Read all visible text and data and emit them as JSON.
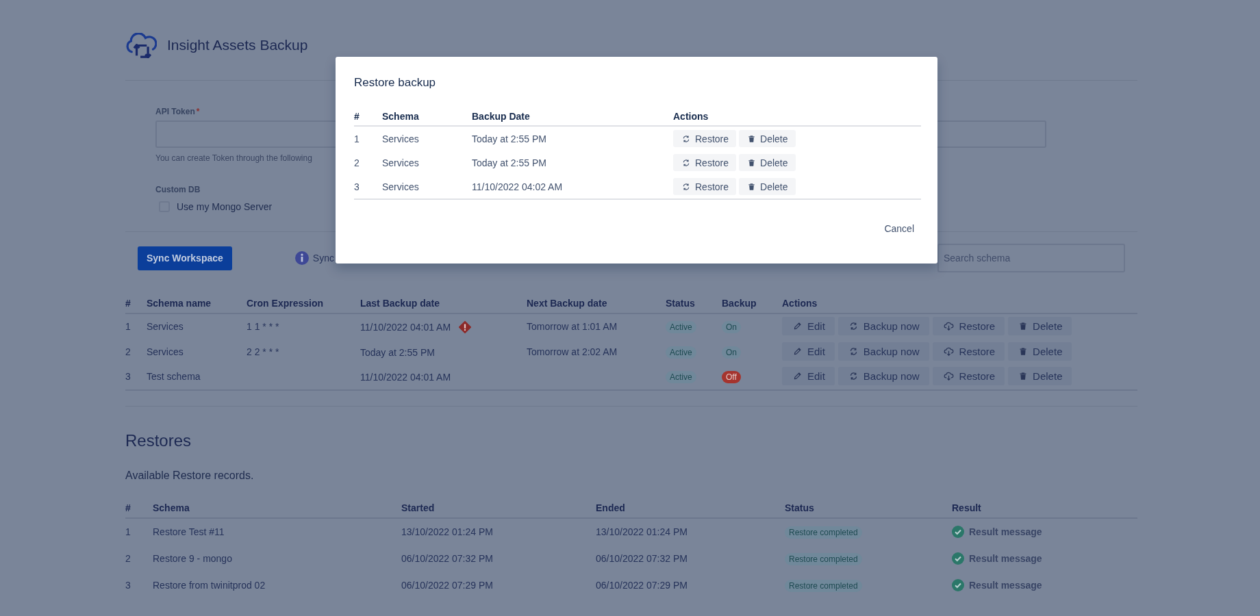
{
  "app": {
    "title": "Insight Assets Backup"
  },
  "settings": {
    "api_token": {
      "label": "API Token",
      "required_mark": "*",
      "helper": "You can create Token through the following"
    },
    "custom_db": {
      "label": "Custom DB",
      "checkbox": {
        "label": "Use my Mongo Server",
        "checked": false
      }
    }
  },
  "toolbar": {
    "sync_button": "Sync Workspace",
    "info_text": "Sync",
    "search": {
      "placeholder": "Search schema"
    }
  },
  "schedules": {
    "columns": [
      "#",
      "Schema name",
      "Cron Expression",
      "Last Backup date",
      "Next Backup date",
      "Status",
      "Backup",
      "Actions"
    ],
    "rows": [
      {
        "index": "1",
        "schema": "Services",
        "cron": "1 1 * * *",
        "last_backup": "11/10/2022 04:01 AM",
        "warning": true,
        "next_backup": "Tomorrow at 1:01 AM",
        "status": "Active",
        "backup": {
          "label": "On",
          "on": true
        },
        "actions": [
          {
            "kind": "edit",
            "label": "Edit"
          },
          {
            "kind": "backup",
            "label": "Backup now"
          },
          {
            "kind": "restore",
            "label": "Restore"
          },
          {
            "kind": "delete",
            "label": "Delete"
          }
        ]
      },
      {
        "index": "2",
        "schema": "Services",
        "cron": "2 2 * * *",
        "last_backup": "Today at 2:55 PM",
        "warning": false,
        "next_backup": "Tomorrow at 2:02 AM",
        "status": "Active",
        "backup": {
          "label": "On",
          "on": true
        },
        "actions": [
          {
            "kind": "edit",
            "label": "Edit"
          },
          {
            "kind": "backup",
            "label": "Backup now"
          },
          {
            "kind": "restore",
            "label": "Restore"
          },
          {
            "kind": "delete",
            "label": "Delete"
          }
        ]
      },
      {
        "index": "3",
        "schema": "Test schema",
        "cron": "",
        "last_backup": "11/10/2022 04:01 AM",
        "warning": false,
        "next_backup": "",
        "status": "Active",
        "backup": {
          "label": "Off",
          "on": false
        },
        "actions": [
          {
            "kind": "edit",
            "label": "Edit"
          },
          {
            "kind": "backup",
            "label": "Backup now"
          },
          {
            "kind": "restore",
            "label": "Restore"
          },
          {
            "kind": "delete",
            "label": "Delete"
          }
        ]
      }
    ]
  },
  "restores": {
    "title": "Restores",
    "description": "Available Restore records.",
    "columns": [
      "#",
      "Schema",
      "Started",
      "Ended",
      "Status",
      "Result"
    ],
    "rows": [
      {
        "index": "1",
        "schema": "Restore Test #11",
        "started": "13/10/2022 01:24 PM",
        "ended": "13/10/2022 01:24 PM",
        "status": "Restore completed",
        "result": "Result message"
      },
      {
        "index": "2",
        "schema": "Restore 9 - mongo",
        "started": "06/10/2022 07:32 PM",
        "ended": "06/10/2022 07:32 PM",
        "status": "Restore completed",
        "result": "Result message"
      },
      {
        "index": "3",
        "schema": "Restore from twinitprod 02",
        "started": "06/10/2022 07:29 PM",
        "ended": "06/10/2022 07:29 PM",
        "status": "Restore completed",
        "result": "Result message"
      }
    ]
  },
  "modal": {
    "title": "Restore backup",
    "columns": [
      "#",
      "Schema",
      "Backup Date",
      "Actions"
    ],
    "rows": [
      {
        "index": "1",
        "schema": "Services",
        "date": "Today at 2:55 PM",
        "actions": [
          {
            "kind": "sync",
            "label": "Restore"
          },
          {
            "kind": "delete",
            "label": "Delete"
          }
        ]
      },
      {
        "index": "2",
        "schema": "Services",
        "date": "Today at 2:55 PM",
        "actions": [
          {
            "kind": "sync",
            "label": "Restore"
          },
          {
            "kind": "delete",
            "label": "Delete"
          }
        ]
      },
      {
        "index": "3",
        "schema": "Services",
        "date": "11/10/2022 04:02 AM",
        "actions": [
          {
            "kind": "sync",
            "label": "Restore"
          },
          {
            "kind": "delete",
            "label": "Delete"
          }
        ]
      }
    ],
    "cancel": "Cancel"
  }
}
